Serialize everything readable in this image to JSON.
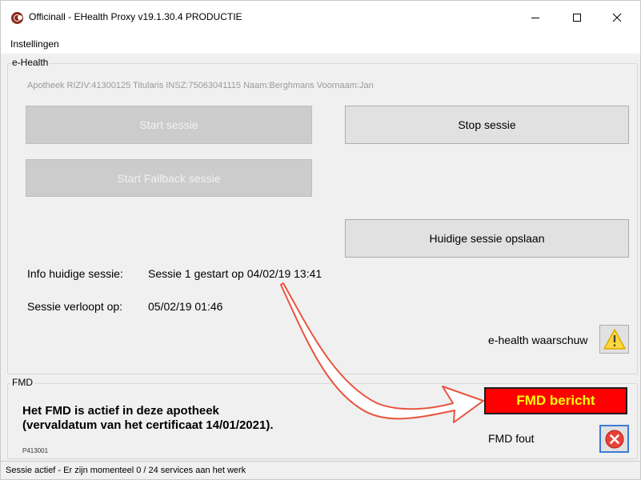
{
  "window": {
    "title": "Officinall - EHealth Proxy  v19.1.30.4  PRODUCTIE"
  },
  "menu": {
    "items": [
      "Instellingen"
    ]
  },
  "ehealth": {
    "group_title": "e-Health",
    "info_line": "Apotheek RIZIV:41300125   Titularis  INSZ:75063041115   Naam:Berghmans   Voornaam:Jan",
    "buttons": {
      "start_session": "Start sessie",
      "start_fallback": "Start Fallback sessie",
      "stop_session": "Stop sessie",
      "save_session": "Huidige sessie opslaan"
    },
    "session_info_label": "Info huidige sessie:",
    "session_info_value": "Sessie 1 gestart op 04/02/19 13:41",
    "session_expires_label": "Sessie verloopt op:",
    "session_expires_value": "05/02/19 01:46",
    "warning_label": "e-health waarschuw"
  },
  "fmd": {
    "group_title": "FMD",
    "status_line1": "Het FMD is actief in deze apotheek",
    "status_line2": "(vervaldatum van het certificaat 14/01/2021).",
    "code": "P413001",
    "message_button": "FMD bericht",
    "error_label": "FMD fout"
  },
  "statusbar": {
    "text": "Sessie actief - Er zijn momenteel 0 / 24 services aan het werk"
  },
  "colors": {
    "fmd_button_bg": "#ff0000",
    "fmd_button_text": "#ffff00",
    "annotation_arrow": "#e8553f"
  },
  "icons": {
    "app": "officinall-app-icon",
    "warning": "warning-triangle-icon",
    "error": "error-x-circle-icon"
  }
}
